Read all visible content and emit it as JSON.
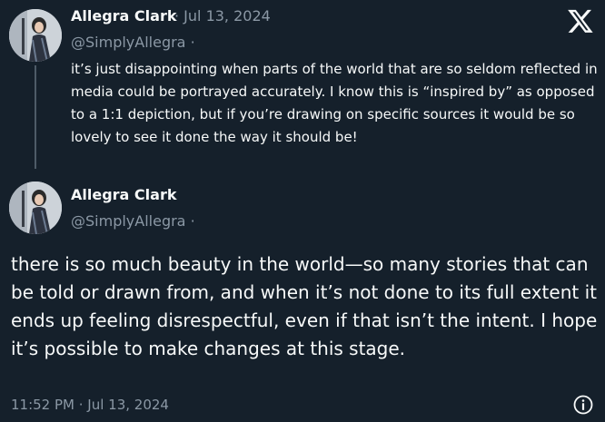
{
  "tweet1": {
    "author_name": "Allegra Clark",
    "date": "· Jul 13, 2024",
    "handle": "@SimplyAllegra ·",
    "text": "it’s just disappointing when parts of the world that are so seldom reflected in media could be portrayed accurately. I know this is “inspired by” as opposed to a 1:1 depiction, but if you’re drawing on specific sources it would be so lovely to see it done the way it should be!"
  },
  "tweet2": {
    "author_name": "Allegra Clark",
    "handle": "@SimplyAllegra ·",
    "text": "there is so much beauty in the world—so many stories that can be told or drawn from, and when it’s not done to its full extent it ends up feeling disrespectful, even if that isn’t the intent. I hope it’s possible to make changes at this stage.",
    "timestamp": "11:52 PM · Jul 13, 2024"
  },
  "icons": {
    "brand": "x-logo-icon",
    "info": "info-icon"
  },
  "colors": {
    "background": "#15202b",
    "text": "#f7f9f9",
    "muted": "#8b98a5",
    "thread_line": "#4e5b67"
  }
}
